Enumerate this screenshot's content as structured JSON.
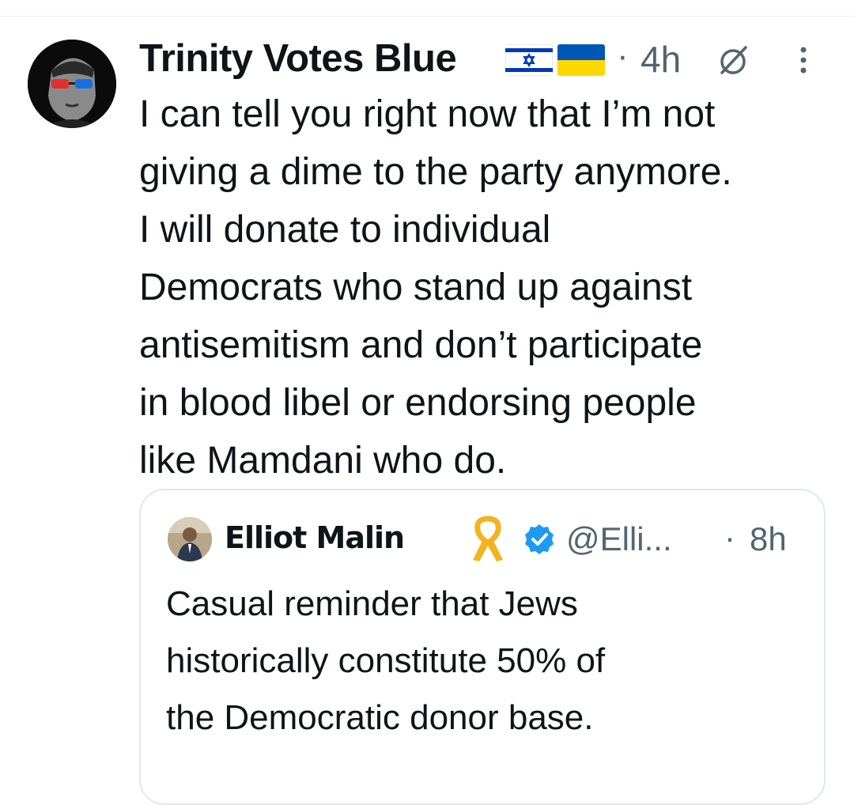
{
  "tweet": {
    "display_name": "Trinity Votes Blue",
    "flags": [
      "israel-flag",
      "ukraine-flag"
    ],
    "separator": "·",
    "time": "4h",
    "text": "I can tell you right now that I’m not\ngiving a dime to the party anymore.\nI will donate to individual\nDemocrats who stand up against\nantisemitism and don’t participate\nin blood libel or endorsing people\nlike Mamdani who do."
  },
  "quoted": {
    "display_name": "Elliot Malin",
    "handle": "@Elli...",
    "separator": "·",
    "time": "8h",
    "text": "Casual reminder that Jews\nhistorically constitute 50% of\nthe Democratic donor base."
  },
  "colors": {
    "text": "#0f1419",
    "secondary": "#536471",
    "verified": "#1d9bf0",
    "ribbon": "#f3b320",
    "israel_blue": "#0038b8",
    "ukraine_blue": "#0057b7",
    "ukraine_yellow": "#ffd700"
  }
}
